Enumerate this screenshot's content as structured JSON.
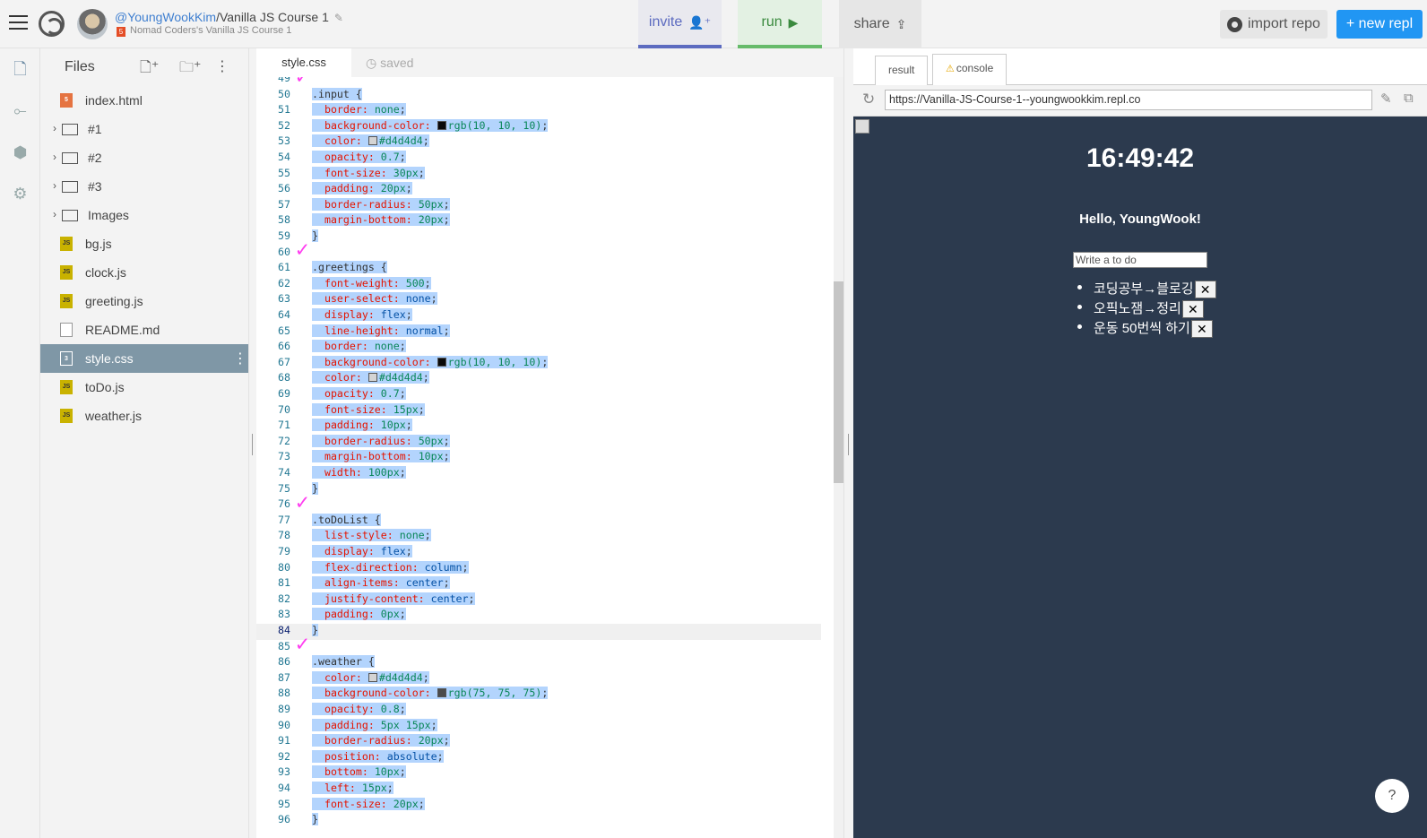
{
  "header": {
    "user_link": "@YoungWookKim",
    "repl_name": "/Vanilla JS Course 1",
    "subtitle": "Nomad Coders's Vanilla JS Course 1",
    "invite_label": "invite",
    "run_label": "run",
    "share_label": "share",
    "import_label": "import repo",
    "new_repl_label": "+ new repl"
  },
  "files": {
    "title": "Files",
    "items": [
      {
        "label": "index.html",
        "type": "html"
      },
      {
        "label": "#1",
        "type": "folder"
      },
      {
        "label": "#2",
        "type": "folder"
      },
      {
        "label": "#3",
        "type": "folder"
      },
      {
        "label": "Images",
        "type": "folder"
      },
      {
        "label": "bg.js",
        "type": "js"
      },
      {
        "label": "clock.js",
        "type": "js"
      },
      {
        "label": "greeting.js",
        "type": "js"
      },
      {
        "label": "README.md",
        "type": "md"
      },
      {
        "label": "style.css",
        "type": "css",
        "active": true
      },
      {
        "label": "toDo.js",
        "type": "js"
      },
      {
        "label": "weather.js",
        "type": "js"
      }
    ]
  },
  "editor": {
    "tab_label": "style.css",
    "saved_label": "saved",
    "current_line": 84,
    "lines": [
      {
        "n": "49",
        "t": ""
      },
      {
        "n": "50",
        "t": ".input {"
      },
      {
        "n": "51",
        "p": "border",
        "v": "none"
      },
      {
        "n": "52",
        "p": "background-color",
        "v": "rgb(10, 10, 10)",
        "swatch": "#0a0a0a"
      },
      {
        "n": "53",
        "p": "color",
        "v": "#d4d4d4",
        "swatch": "#d4d4d4"
      },
      {
        "n": "54",
        "p": "opacity",
        "v": "0.7"
      },
      {
        "n": "55",
        "p": "font-size",
        "v": "30px"
      },
      {
        "n": "56",
        "p": "padding",
        "v": "20px"
      },
      {
        "n": "57",
        "p": "border-radius",
        "v": "50px"
      },
      {
        "n": "58",
        "p": "margin-bottom",
        "v": "20px"
      },
      {
        "n": "59",
        "t": "}"
      },
      {
        "n": "60",
        "t": ""
      },
      {
        "n": "61",
        "t": ".greetings {"
      },
      {
        "n": "62",
        "p": "font-weight",
        "v": "500"
      },
      {
        "n": "63",
        "p": "user-select",
        "v": "none",
        "kw": true
      },
      {
        "n": "64",
        "p": "display",
        "v": "flex",
        "kw": true
      },
      {
        "n": "65",
        "p": "line-height",
        "v": "normal",
        "kw": true
      },
      {
        "n": "66",
        "p": "border",
        "v": "none"
      },
      {
        "n": "67",
        "p": "background-color",
        "v": "rgb(10, 10, 10)",
        "swatch": "#0a0a0a"
      },
      {
        "n": "68",
        "p": "color",
        "v": "#d4d4d4",
        "swatch": "#d4d4d4"
      },
      {
        "n": "69",
        "p": "opacity",
        "v": "0.7"
      },
      {
        "n": "70",
        "p": "font-size",
        "v": "15px"
      },
      {
        "n": "71",
        "p": "padding",
        "v": "10px"
      },
      {
        "n": "72",
        "p": "border-radius",
        "v": "50px"
      },
      {
        "n": "73",
        "p": "margin-bottom",
        "v": "10px"
      },
      {
        "n": "74",
        "p": "width",
        "v": "100px"
      },
      {
        "n": "75",
        "t": "}"
      },
      {
        "n": "76",
        "t": ""
      },
      {
        "n": "77",
        "t": ".toDoList {"
      },
      {
        "n": "78",
        "p": "list-style",
        "v": "none"
      },
      {
        "n": "79",
        "p": "display",
        "v": "flex",
        "kw": true
      },
      {
        "n": "80",
        "p": "flex-direction",
        "v": "column",
        "kw": true
      },
      {
        "n": "81",
        "p": "align-items",
        "v": "center",
        "kw": true
      },
      {
        "n": "82",
        "p": "justify-content",
        "v": "center",
        "kw": true
      },
      {
        "n": "83",
        "p": "padding",
        "v": "0px"
      },
      {
        "n": "84",
        "t": "}"
      },
      {
        "n": "85",
        "t": ""
      },
      {
        "n": "86",
        "t": ".weather {"
      },
      {
        "n": "87",
        "p": "color",
        "v": "#d4d4d4",
        "swatch": "#d4d4d4"
      },
      {
        "n": "88",
        "p": "background-color",
        "v": "rgb(75, 75, 75)",
        "swatch": "#4b4b4b"
      },
      {
        "n": "89",
        "p": "opacity",
        "v": "0.8"
      },
      {
        "n": "90",
        "p": "padding",
        "v": "5px 15px"
      },
      {
        "n": "91",
        "p": "border-radius",
        "v": "20px"
      },
      {
        "n": "92",
        "p": "position",
        "v": "absolute",
        "kw": true
      },
      {
        "n": "93",
        "p": "bottom",
        "v": "10px"
      },
      {
        "n": "94",
        "p": "left",
        "v": "15px"
      },
      {
        "n": "95",
        "p": "font-size",
        "v": "20px"
      },
      {
        "n": "96",
        "t": "}"
      }
    ]
  },
  "output": {
    "result_tab": "result",
    "console_tab": "console",
    "url": "https://Vanilla-JS-Course-1--youngwookkim.repl.co",
    "clock": "16:49:42",
    "greeting": "Hello, YoungWook!",
    "todo_placeholder": "Write a to do",
    "todos": [
      "코딩공부→블로깅",
      "오픽노잼→정리",
      "운동 50번씩 하기"
    ],
    "delete_label": "✕"
  },
  "colors": {
    "accent": "#2196f3",
    "preview_bg": "#2c3a4e",
    "selection": "#b3d4fd",
    "check_mark": "#ff3df0"
  }
}
